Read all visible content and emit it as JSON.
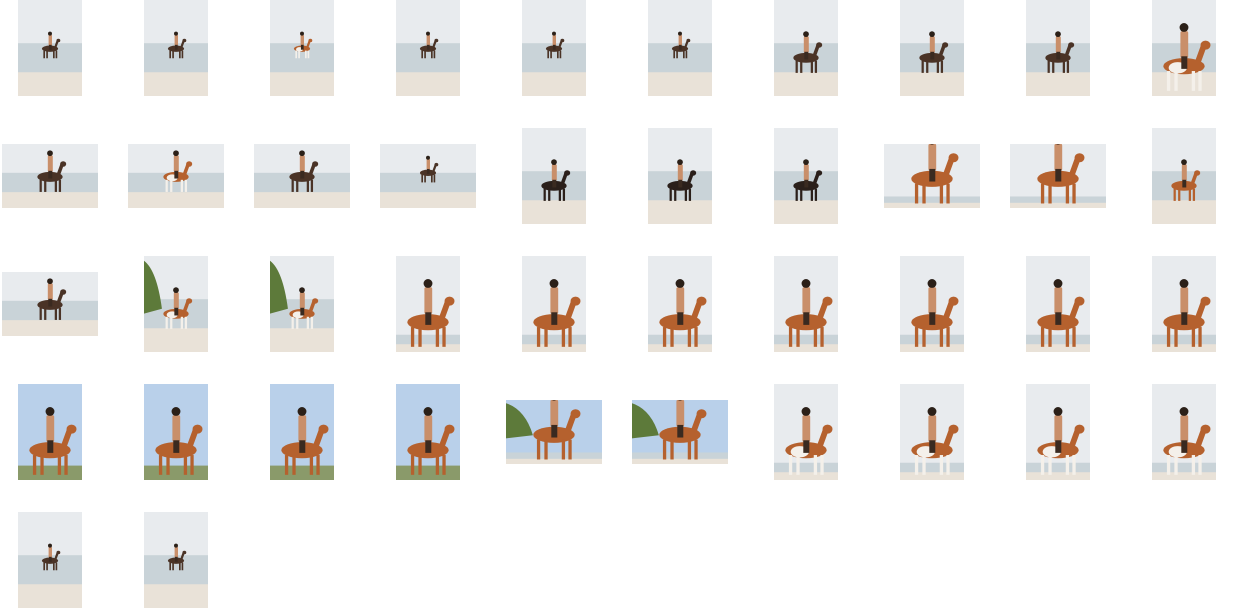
{
  "gallery": {
    "thumbnails": [
      {
        "orientation": "portrait",
        "scene": "beach-distant",
        "horse": "dark"
      },
      {
        "orientation": "portrait",
        "scene": "beach-distant",
        "horse": "dark"
      },
      {
        "orientation": "portrait",
        "scene": "beach-distant",
        "horse": "pinto"
      },
      {
        "orientation": "portrait",
        "scene": "beach-distant",
        "horse": "dark"
      },
      {
        "orientation": "portrait",
        "scene": "beach-distant",
        "horse": "dark"
      },
      {
        "orientation": "portrait",
        "scene": "beach-distant",
        "horse": "dark"
      },
      {
        "orientation": "portrait",
        "scene": "beach-mid",
        "horse": "dark"
      },
      {
        "orientation": "portrait",
        "scene": "beach-mid",
        "horse": "dark"
      },
      {
        "orientation": "portrait",
        "scene": "beach-mid",
        "horse": "dark"
      },
      {
        "orientation": "portrait",
        "scene": "beach-close",
        "horse": "pinto"
      },
      {
        "orientation": "landscape",
        "scene": "beach-mid",
        "horse": "dark"
      },
      {
        "orientation": "landscape",
        "scene": "beach-mid",
        "horse": "pinto"
      },
      {
        "orientation": "landscape",
        "scene": "beach-mid",
        "horse": "dark"
      },
      {
        "orientation": "landscape",
        "scene": "beach-distant",
        "horse": "dark"
      },
      {
        "orientation": "portrait",
        "scene": "beach-mid",
        "horse": "black"
      },
      {
        "orientation": "portrait",
        "scene": "beach-mid",
        "horse": "black"
      },
      {
        "orientation": "portrait",
        "scene": "beach-mid",
        "horse": "black"
      },
      {
        "orientation": "landscape",
        "scene": "sky-close",
        "horse": "chestnut"
      },
      {
        "orientation": "landscape",
        "scene": "sky-close",
        "horse": "chestnut"
      },
      {
        "orientation": "portrait",
        "scene": "beach-mid",
        "horse": "chestnut"
      },
      {
        "orientation": "landscape",
        "scene": "beach-mid",
        "horse": "dark"
      },
      {
        "orientation": "portrait",
        "scene": "trees-beach",
        "horse": "pinto"
      },
      {
        "orientation": "portrait",
        "scene": "trees-beach",
        "horse": "pinto"
      },
      {
        "orientation": "portrait",
        "scene": "sky-close",
        "horse": "chestnut"
      },
      {
        "orientation": "portrait",
        "scene": "sky-close",
        "horse": "chestnut"
      },
      {
        "orientation": "portrait",
        "scene": "sky-close",
        "horse": "chestnut"
      },
      {
        "orientation": "portrait",
        "scene": "sky-close",
        "horse": "chestnut"
      },
      {
        "orientation": "portrait",
        "scene": "sky-close",
        "horse": "chestnut"
      },
      {
        "orientation": "portrait",
        "scene": "sky-close",
        "horse": "chestnut"
      },
      {
        "orientation": "portrait",
        "scene": "sky-close",
        "horse": "chestnut"
      },
      {
        "orientation": "portrait",
        "scene": "blue-sky",
        "horse": "chestnut"
      },
      {
        "orientation": "portrait",
        "scene": "blue-sky",
        "horse": "chestnut"
      },
      {
        "orientation": "portrait",
        "scene": "blue-sky",
        "horse": "chestnut"
      },
      {
        "orientation": "portrait",
        "scene": "blue-sky",
        "horse": "chestnut"
      },
      {
        "orientation": "landscape",
        "scene": "palm-sky",
        "horse": "chestnut"
      },
      {
        "orientation": "landscape",
        "scene": "palm-sky",
        "horse": "chestnut"
      },
      {
        "orientation": "portrait",
        "scene": "sky-close",
        "horse": "pinto"
      },
      {
        "orientation": "portrait",
        "scene": "sky-close",
        "horse": "pinto"
      },
      {
        "orientation": "portrait",
        "scene": "sky-close",
        "horse": "pinto"
      },
      {
        "orientation": "portrait",
        "scene": "sky-close",
        "horse": "pinto"
      },
      {
        "orientation": "portrait",
        "scene": "beach-distant",
        "horse": "dark"
      },
      {
        "orientation": "portrait",
        "scene": "beach-distant",
        "horse": "dark"
      }
    ]
  },
  "colors": {
    "page_bg": "#ffffff",
    "sky_hazy": "#e8ebee",
    "sky_blue": "#b9d0ea",
    "sea": "#c9d3d8",
    "sand": "#e9e2d8",
    "horse_chestnut": "#b5612e",
    "horse_dark": "#4a3326",
    "horse_black": "#2a1f1a",
    "horse_white": "#f4f0ea",
    "skin": "#c98f6a",
    "palm": "#5d7a3a"
  }
}
